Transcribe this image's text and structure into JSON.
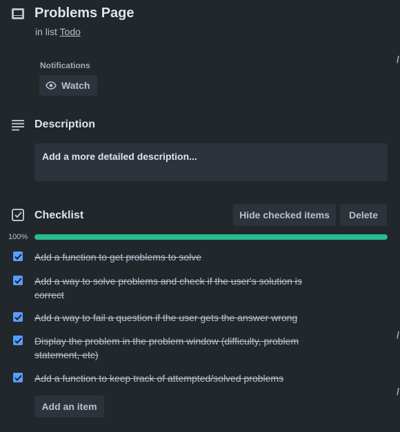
{
  "card": {
    "icon": "card-icon",
    "title": "Problems Page",
    "list_prefix": "in list",
    "list_name": "Todo"
  },
  "notifications": {
    "label": "Notifications",
    "watch_label": "Watch",
    "watch_icon": "eye-icon"
  },
  "description": {
    "icon": "description-icon",
    "title": "Description",
    "placeholder": "Add a more detailed description..."
  },
  "checklist": {
    "icon": "checklist-icon",
    "title": "Checklist",
    "hide_checked_label": "Hide checked items",
    "delete_label": "Delete",
    "progress_label": "100%",
    "progress_percent": 100,
    "items": [
      {
        "text": "Add a function to get problems to solve",
        "checked": true
      },
      {
        "text": "Add a way to solve problems and check if the user's solution is correct",
        "checked": true
      },
      {
        "text": "Add a way to fail a question if the user gets the answer wrong",
        "checked": true
      },
      {
        "text": "Display the problem in the problem window (difficulty, problem statement, etc)",
        "checked": true
      },
      {
        "text": "Add a function to keep track of attempted/solved problems",
        "checked": true
      }
    ],
    "add_item_label": "Add an item"
  },
  "colors": {
    "background": "#22272b",
    "button": "#2c333a",
    "checkbox": "#579dff",
    "progress": "#2abb8f"
  }
}
